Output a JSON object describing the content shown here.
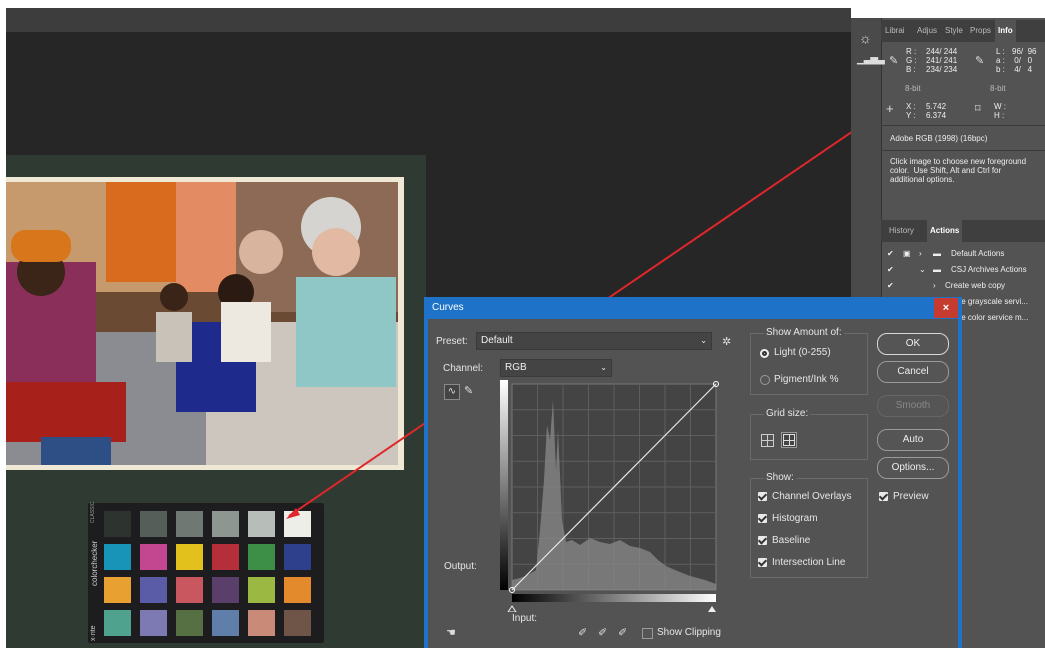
{
  "info_panel": {
    "tabs": [
      "Librai",
      "Adjus",
      "Style",
      "Props",
      "Info"
    ],
    "active_tab": "Info",
    "rgb_labels": "R :\nG :\nB :",
    "rgb_values": "244/ 244\n241/ 241\n234/ 234",
    "lab_labels": "L :\na :\nb :",
    "lab_values": "96/  96\n 0/   0\n 4/   4",
    "bit_depth_left": "8-bit",
    "bit_depth_right": "8-bit",
    "xy_labels": "X :\nY :",
    "xy_values": "5.742\n6.374",
    "wh_labels": "W :\nH :",
    "profile": "Adobe RGB (1998) (16bpc)",
    "help": "Click image to choose new foreground\ncolor.  Use Shift, Alt and Ctrl for\nadditional options."
  },
  "actions_panel": {
    "tabs": [
      "History",
      "Actions"
    ],
    "active_tab": "Actions",
    "items": [
      {
        "label": "Default Actions"
      },
      {
        "label": "CSJ Archives Actions"
      },
      {
        "label": "Create web copy"
      },
      {
        "label": "te grayscale servi..."
      },
      {
        "label": "te color service m..."
      }
    ]
  },
  "curves": {
    "title": "Curves",
    "preset_label": "Preset:",
    "preset_value": "Default",
    "channel_label": "Channel:",
    "channel_value": "RGB",
    "output_label": "Output:",
    "input_label": "Input:",
    "show_amount_title": "Show Amount of:",
    "light_label": "Light  (0-255)",
    "pigment_label": "Pigment/Ink %",
    "grid_size_title": "Grid size:",
    "show_title": "Show:",
    "checkboxes": [
      "Channel Overlays",
      "Histogram",
      "Baseline",
      "Intersection Line"
    ],
    "buttons": {
      "ok": "OK",
      "cancel": "Cancel",
      "smooth": "Smooth",
      "auto": "Auto",
      "options": "Options..."
    },
    "preview_label": "Preview",
    "show_clipping_label": "Show Clipping"
  },
  "checker": {
    "brand": "colorchecker",
    "brand_sub": "CLASSIC",
    "maker": "x·rite",
    "rows": [
      [
        "#2d332f",
        "#555e58",
        "#6f7872",
        "#8e9691",
        "#b7bdb8",
        "#eeeee8"
      ],
      [
        "#1794b8",
        "#c24690",
        "#e2c11d",
        "#b52f3a",
        "#3d8f47",
        "#2e3f8c"
      ],
      [
        "#e8a131",
        "#5a5ca7",
        "#c8575f",
        "#5a3f6a",
        "#9ab842",
        "#e38b2c"
      ],
      [
        "#4fa38e",
        "#7c79b3",
        "#566f43",
        "#5f7faa",
        "#c98a78",
        "#6e5547"
      ]
    ]
  },
  "colors": {
    "annotation": "#e0262a",
    "dialog_title": "#1e73c8",
    "dialog_body": "#535353"
  }
}
